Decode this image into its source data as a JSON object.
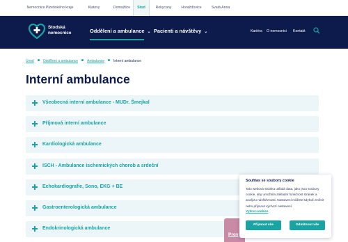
{
  "network_bar": {
    "tabs": [
      {
        "label": "Nemocnice Plzeňského kraje",
        "active": false
      },
      {
        "label": "Klatovy",
        "active": false
      },
      {
        "label": "Domažlice",
        "active": false
      },
      {
        "label": "Stod",
        "active": true
      },
      {
        "label": "Rokycany",
        "active": false
      },
      {
        "label": "Horažďovice",
        "active": false
      },
      {
        "label": "Svatá Anna",
        "active": false
      }
    ]
  },
  "header": {
    "logo_line1": "Stodská",
    "logo_line2": "nemocnice",
    "nav": [
      {
        "label": "Oddělení a ambulance"
      },
      {
        "label": "Pacienti a návštěvy"
      }
    ],
    "utility": [
      "Kariéra",
      "O nemocnici",
      "Kontakt"
    ]
  },
  "breadcrumb": [
    "Úvod",
    "Oddělení a ambulance",
    "Ambulance",
    "Interní ambulance"
  ],
  "page_title": "Interní ambulance",
  "accordion": [
    "Všeobecná interní ambulance - MUDr. Šmejkal",
    "Příjmová interní ambulance",
    "Kardiologická ambulance",
    "ISCH - Ambulance ischemických chorob a srdeční",
    "Echokardiografie, Sono, EKG + BE",
    "Gastroenterologická ambulance",
    "Endokrinologická ambulance"
  ],
  "feedback_tab": {
    "label": "Prov"
  },
  "cookie_banner": {
    "title": "Souhlas se soubory cookie",
    "text": "Tato webová stránka ukládá data, jako jsou soubory cookie, aby umožnila základní funkčnost stránek a analýzu návštěvnosti. Nastavení můžete kdykoli změnit nebo přijmout výchozí nastavení.",
    "link": "Vybrat cookies",
    "accept_label": "Přijmout vše",
    "reject_label": "Odmítnout vše"
  },
  "colors": {
    "navy": "#0d1b4c",
    "teal": "#19a3a3",
    "accordion_bg": "#ecf5f7",
    "feedback_pink": "#c98aa6"
  },
  "icons": [
    "logo-cross-heart-icon",
    "chevron-down-icon",
    "search-icon",
    "plus-icon"
  ]
}
